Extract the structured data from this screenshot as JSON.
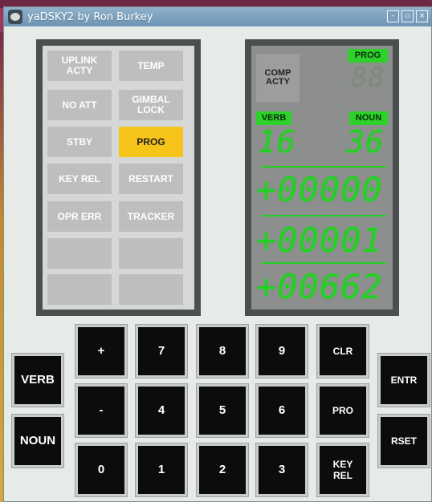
{
  "window": {
    "title": "yaDSKY2 by Ron Burkey",
    "controls": {
      "minimize": "–",
      "maximize": "▫",
      "close": "×"
    }
  },
  "indicators": [
    {
      "id": "uplink",
      "label": "UPLINK\nACTY",
      "lit": false
    },
    {
      "id": "temp",
      "label": "TEMP",
      "lit": false
    },
    {
      "id": "noatt",
      "label": "NO ATT",
      "lit": false
    },
    {
      "id": "gimbal",
      "label": "GIMBAL\nLOCK",
      "lit": false
    },
    {
      "id": "stby",
      "label": "STBY",
      "lit": false
    },
    {
      "id": "prog",
      "label": "PROG",
      "lit": true
    },
    {
      "id": "keyrel",
      "label": "KEY REL",
      "lit": false
    },
    {
      "id": "restart",
      "label": "RESTART",
      "lit": false
    },
    {
      "id": "oprerr",
      "label": "OPR ERR",
      "lit": false
    },
    {
      "id": "tracker",
      "label": "TRACKER",
      "lit": false
    }
  ],
  "display": {
    "comp_acty": "COMP\nACTY",
    "prog_label": "PROG",
    "prog_value": "88",
    "verb_label": "VERB",
    "noun_label": "NOUN",
    "verb_value": "16",
    "noun_value": "36",
    "r1": "+00000",
    "r2": "+00001",
    "r3": "+00662",
    "colors": {
      "lit": "#22d022",
      "dim": "#7e8a7e"
    }
  },
  "keys": {
    "verb": "VERB",
    "noun": "NOUN",
    "plus": "+",
    "minus": "-",
    "zero": "0",
    "k7": "7",
    "k8": "8",
    "k9": "9",
    "k4": "4",
    "k5": "5",
    "k6": "6",
    "k1": "1",
    "k2": "2",
    "k3": "3",
    "clr": "CLR",
    "pro": "PRO",
    "keyrel": "KEY\nREL",
    "entr": "ENTR",
    "rset": "RSET"
  }
}
